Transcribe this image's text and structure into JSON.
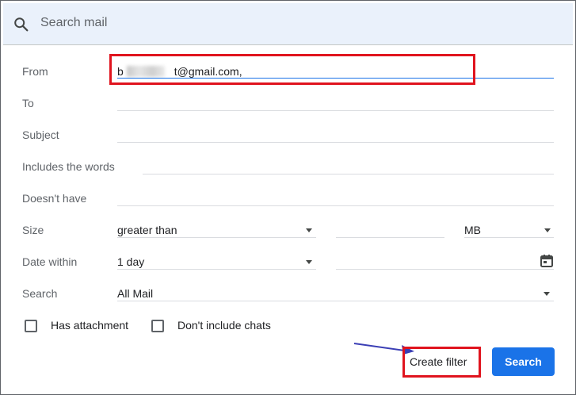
{
  "search": {
    "placeholder": "Search mail",
    "icon": "search-icon"
  },
  "fields": {
    "from_label": "From",
    "from_value_start": "b",
    "from_value_end": "t@gmail.com,",
    "to_label": "To",
    "subject_label": "Subject",
    "includes_label": "Includes the words",
    "doesnt_have_label": "Doesn't have",
    "size_label": "Size",
    "size_operator": "greater than",
    "size_unit": "MB",
    "date_within_label": "Date within",
    "date_within_value": "1 day",
    "search_label": "Search",
    "search_scope": "All Mail"
  },
  "checkboxes": {
    "has_attachment": "Has attachment",
    "dont_include_chats": "Don't include chats"
  },
  "buttons": {
    "create_filter": "Create filter",
    "search": "Search"
  },
  "colors": {
    "accent": "#1a73e8",
    "highlight": "#e0141e",
    "searchbar_bg": "#eaf1fb"
  }
}
